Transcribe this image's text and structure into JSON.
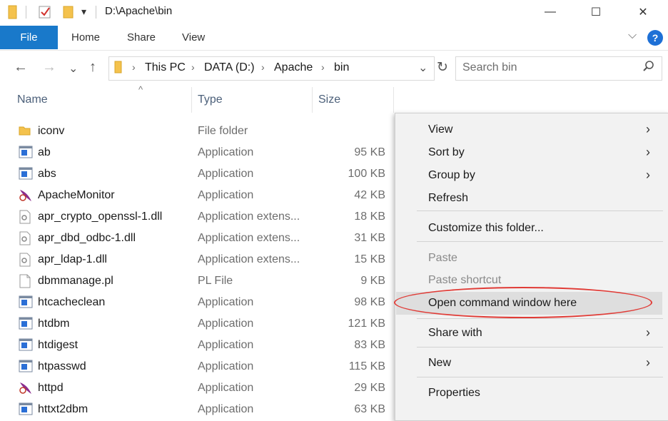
{
  "window": {
    "title": "D:\\Apache\\bin",
    "minimize": "—",
    "maximize": "☐",
    "close": "✕"
  },
  "quick_access": {
    "dropdown_glyph": "▾"
  },
  "ribbon": {
    "tabs": [
      "File",
      "Home",
      "Share",
      "View"
    ],
    "help": "?",
    "chevron": "⌵"
  },
  "nav": {
    "back": "←",
    "forward": "→",
    "recent": "⌄",
    "up": "↑",
    "refresh": "↻",
    "dropdown": "⌄"
  },
  "breadcrumb": [
    "This PC",
    "DATA (D:)",
    "Apache",
    "bin"
  ],
  "breadcrumb_separator": "›",
  "search": {
    "placeholder": "Search bin",
    "icon": "⚲"
  },
  "columns": {
    "name": "Name",
    "type": "Type",
    "size": "Size",
    "sort_glyph": "^"
  },
  "files": [
    {
      "name": "iconv",
      "type": "File folder",
      "size": "",
      "icon": "folder-icon"
    },
    {
      "name": "ab",
      "type": "Application",
      "size": "95 KB",
      "icon": "app-icon"
    },
    {
      "name": "abs",
      "type": "Application",
      "size": "100 KB",
      "icon": "app-icon"
    },
    {
      "name": "ApacheMonitor",
      "type": "Application",
      "size": "42 KB",
      "icon": "apache-feather-icon"
    },
    {
      "name": "apr_crypto_openssl-1.dll",
      "type": "Application extens...",
      "size": "18 KB",
      "icon": "dll-icon"
    },
    {
      "name": "apr_dbd_odbc-1.dll",
      "type": "Application extens...",
      "size": "31 KB",
      "icon": "dll-icon"
    },
    {
      "name": "apr_ldap-1.dll",
      "type": "Application extens...",
      "size": "15 KB",
      "icon": "dll-icon"
    },
    {
      "name": "dbmmanage.pl",
      "type": "PL File",
      "size": "9 KB",
      "icon": "file-icon"
    },
    {
      "name": "htcacheclean",
      "type": "Application",
      "size": "98 KB",
      "icon": "app-icon"
    },
    {
      "name": "htdbm",
      "type": "Application",
      "size": "121 KB",
      "icon": "app-icon"
    },
    {
      "name": "htdigest",
      "type": "Application",
      "size": "83 KB",
      "icon": "app-icon"
    },
    {
      "name": "htpasswd",
      "type": "Application",
      "size": "115 KB",
      "icon": "app-icon"
    },
    {
      "name": "httpd",
      "type": "Application",
      "size": "29 KB",
      "icon": "apache-feather-icon"
    },
    {
      "name": "httxt2dbm",
      "type": "Application",
      "size": "63 KB",
      "icon": "app-icon"
    }
  ],
  "context_menu": {
    "arrow": "›",
    "items": [
      {
        "label": "View",
        "submenu": true,
        "disabled": false
      },
      {
        "label": "Sort by",
        "submenu": true,
        "disabled": false
      },
      {
        "label": "Group by",
        "submenu": true,
        "disabled": false
      },
      {
        "label": "Refresh",
        "submenu": false,
        "disabled": false
      },
      {
        "label": "Customize this folder...",
        "submenu": false,
        "disabled": false
      },
      {
        "label": "Paste",
        "submenu": false,
        "disabled": true
      },
      {
        "label": "Paste shortcut",
        "submenu": false,
        "disabled": true
      },
      {
        "label": "Open command window here",
        "submenu": false,
        "disabled": false,
        "highlighted": true,
        "circled": true
      },
      {
        "label": "Share with",
        "submenu": true,
        "disabled": false
      },
      {
        "label": "New",
        "submenu": true,
        "disabled": false
      },
      {
        "label": "Properties",
        "submenu": false,
        "disabled": false
      }
    ]
  },
  "colors": {
    "accent": "#1979ca",
    "highlight_ring": "#e03b36",
    "menu_bg": "#f2f2f2",
    "folder": "#f4c24d"
  }
}
